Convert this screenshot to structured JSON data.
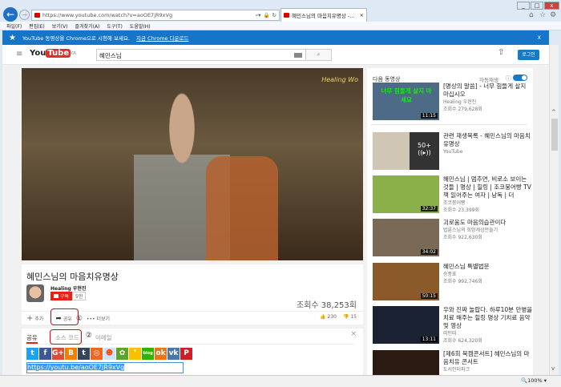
{
  "browser": {
    "url": "https://www.youtube.com/watch?v=aoOE7jR9xVg",
    "tab_title": "혜민스님의 마음치유명상 -...",
    "menu": [
      "파일(F)",
      "편집(E)",
      "보기(V)",
      "즐겨찾기(A)",
      "도구(T)",
      "도움말(H)"
    ],
    "zoom": "100%"
  },
  "banner": {
    "text": "YouTube 동영상을 Chrome으로 시청해 보세요.",
    "link": "지금 Chrome 다운로드",
    "close": "X"
  },
  "header": {
    "logo_you": "You",
    "logo_tube": "Tube",
    "region": "KR",
    "search_value": "혜민스님",
    "login": "로그인"
  },
  "video": {
    "overlay": "Healing Wo",
    "title": "혜민스님의 마음치유명상",
    "channel": "Healing 우현진",
    "subscribe": "구독",
    "sub_count": "5만",
    "views": "조회수 38,253회",
    "add": "추가",
    "share": "공유",
    "more": "더보기",
    "likes": "230",
    "dislikes": "15",
    "marker1": "①",
    "marker2": "②"
  },
  "share": {
    "tabs": [
      "공유",
      "소스 코드",
      "이메일"
    ],
    "close": "×",
    "url": "https://youtu.be/aoOE7jR9xVg",
    "icons": [
      {
        "name": "twitter",
        "color": "#1da1f2",
        "g": "t"
      },
      {
        "name": "facebook",
        "color": "#3b5998",
        "g": "f"
      },
      {
        "name": "google-plus",
        "color": "#dd4b39",
        "g": "G+"
      },
      {
        "name": "blogger",
        "color": "#f57d00",
        "g": "B"
      },
      {
        "name": "tumblr",
        "color": "#35465c",
        "g": "t"
      },
      {
        "name": "daum",
        "color": "#f0651f",
        "g": "◎"
      },
      {
        "name": "reddit",
        "color": "#cee3f8",
        "g": "☻"
      },
      {
        "name": "kakaostory",
        "color": "#59a42e",
        "g": "✿"
      },
      {
        "name": "band",
        "color": "#f9c000",
        "g": "❜"
      },
      {
        "name": "naver-blog",
        "color": "#2db400",
        "g": "blog"
      },
      {
        "name": "odnoklassniki",
        "color": "#f2720c",
        "g": "ok"
      },
      {
        "name": "vk",
        "color": "#4a76a8",
        "g": "vk"
      },
      {
        "name": "pinterest",
        "color": "#cb2027",
        "g": "P"
      }
    ]
  },
  "sidebar": {
    "heading": "다음 동영상",
    "autoplay": "자동재생",
    "items": [
      {
        "title": "[명상의 말씀] - 너무 힘들게 살지 마십시오",
        "channel": "Healing 우현진",
        "views": "조회수 279,628회",
        "duration": "11:15",
        "thumb_text": "너무 힘들게 살지 마세요",
        "bg": "#4d6a86"
      },
      {
        "title": "관련 재생목록 - 혜민스님의 마음치유명상",
        "channel": "YouTube",
        "views": "",
        "duration": "",
        "playlist": "50+",
        "bg": "#cfc6b5"
      },
      {
        "title": "혜민스님 | 멈추면, 비로소 보이는 것들 | 명상 | 힐링 | 조코붕어빵 TV 책 읽어주는 여자 | 낭독 | 더",
        "channel": "조코붕어빵",
        "views": "조회수 23,399회",
        "duration": "32:37",
        "bg": "#8bb04a"
      },
      {
        "title": "괴로움도 마음의습관이다",
        "channel": "법륜스님의 희망세상만들기",
        "views": "조회수 922,630회",
        "duration": "34:02",
        "bg": "#7a6a55"
      },
      {
        "title": "혜민스님 특별법문",
        "channel": "승풍표",
        "views": "조회수 992,746회",
        "duration": "50:15",
        "bg": "#8a5a2a"
      },
      {
        "title": "우와 진짜 놀랍다. 하루10분 만병을 치료 해주는 힐링 명상 기치료 음악 및 영상",
        "channel": "띠띤따",
        "views": "조회수 624,320회",
        "duration": "13:11",
        "bg": "#1a2233"
      },
      {
        "title": "[제6회 북캠콘서트] 혜민스님의 마음치유 콘서트",
        "channel": "도서인터파크",
        "views": "",
        "duration": "",
        "bg": "#2a1a12"
      }
    ]
  }
}
